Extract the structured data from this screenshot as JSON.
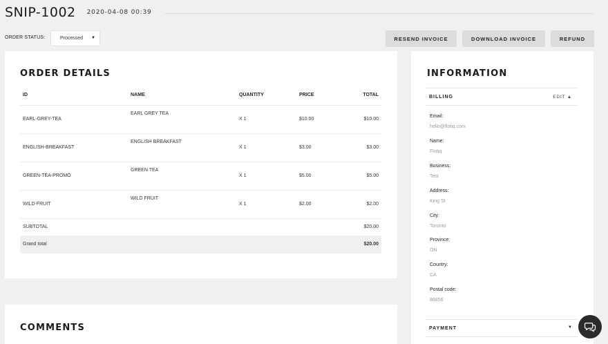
{
  "header": {
    "order_id": "SNIP-1002",
    "date": "2020-04-08 00:39"
  },
  "status": {
    "label": "ORDER STATUS:",
    "value": "Processed",
    "caret": "▼"
  },
  "actions": {
    "resend": "RESEND INVOICE",
    "download": "DOWNLOAD INVOICE",
    "refund": "REFUND"
  },
  "order": {
    "title": "ORDER DETAILS",
    "columns": [
      "ID",
      "NAME",
      "QUANTITY",
      "PRICE",
      "TOTAL"
    ],
    "rows": [
      {
        "id": "EARL-GREY-TEA",
        "name": "EARL GREY TEA",
        "qty": "X 1",
        "price": "$10.00",
        "total": "$10.00"
      },
      {
        "id": "ENGLISH-BREAKFAST",
        "name": "ENGLISH BREAKFAST",
        "qty": "X 1",
        "price": "$3.00",
        "total": "$3.00"
      },
      {
        "id": "GREEN-TEA-PROMO",
        "name": "GREEN TEA",
        "qty": "X 1",
        "price": "$5.00",
        "total": "$5.00"
      },
      {
        "id": "WILD-FRUIT",
        "name": "WILD FRUIT",
        "qty": "X 1",
        "price": "$2.00",
        "total": "$2.00"
      }
    ],
    "subtotal_label": "SUBTOTAL",
    "subtotal": "$20.00",
    "grand_label": "Grand total",
    "grand": "$20.00"
  },
  "comments": {
    "title": "COMMENTS"
  },
  "info": {
    "title": "INFORMATION",
    "billing_label": "BILLING",
    "edit_label": "EDIT ▲",
    "fields": [
      {
        "label": "Email:",
        "value": "hello@flotiq.com"
      },
      {
        "label": "Name:",
        "value": "Flotiq"
      },
      {
        "label": "Business:",
        "value": "Test"
      },
      {
        "label": "Address:",
        "value": "King St"
      },
      {
        "label": "City:",
        "value": "Toronto"
      },
      {
        "label": "Province:",
        "value": "ON"
      },
      {
        "label": "Country:",
        "value": "CA"
      },
      {
        "label": "Postal code:",
        "value": "86856"
      }
    ],
    "payment_label": "PAYMENT",
    "payment_caret": "▼"
  },
  "icons": {
    "chat": "chat-bubbles-icon"
  },
  "colors": {
    "button_bg": "#dcdcdc",
    "page_bg": "#f0f0f0",
    "card_bg": "#ffffff",
    "chat_bg": "#2b2b2b"
  }
}
